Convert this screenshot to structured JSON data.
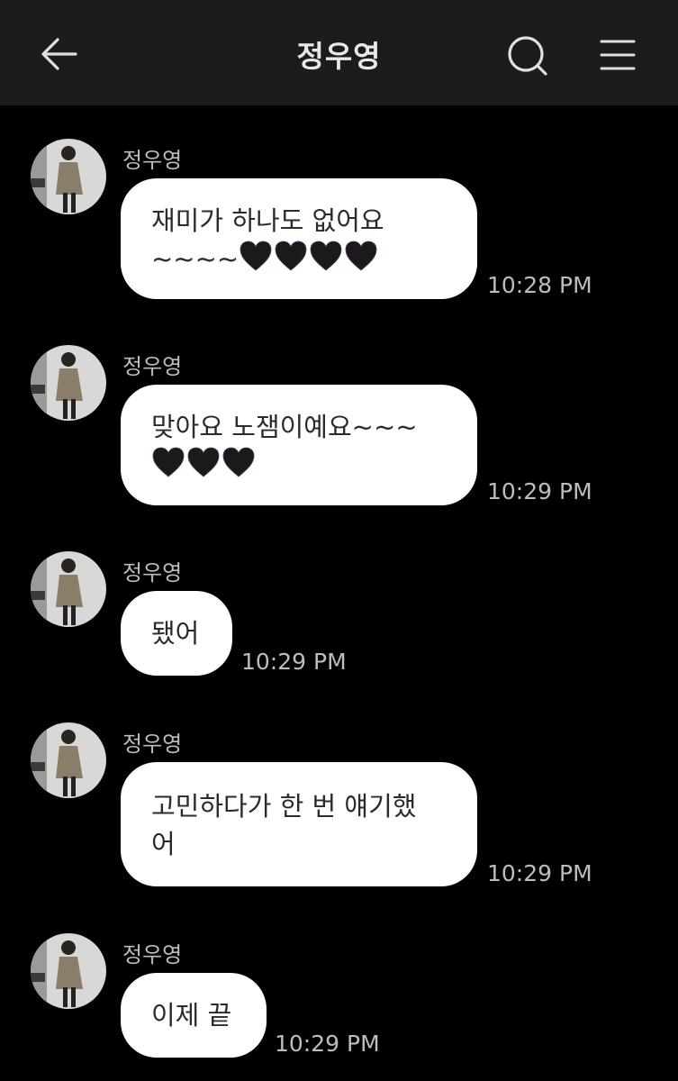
{
  "header": {
    "title": "정우영",
    "back_icon": "arrow-left-icon",
    "search_icon": "search-icon",
    "menu_icon": "hamburger-menu-icon"
  },
  "colors": {
    "background": "#000000",
    "header_bg": "#1c1c1e",
    "bubble": "#ffffff",
    "text_light": "#bdbdbd",
    "heart": "#1a1a1a"
  },
  "messages": [
    {
      "sender": "정우영",
      "lines": [
        "재미가 하나도 없어요",
        "~~~~"
      ],
      "hearts": 4,
      "time": "10:28 PM"
    },
    {
      "sender": "정우영",
      "lines": [
        "맞아요 노잼이예요~~~",
        ""
      ],
      "hearts": 3,
      "time": "10:29 PM"
    },
    {
      "sender": "정우영",
      "lines": [
        "됐어"
      ],
      "hearts": 0,
      "time": "10:29 PM"
    },
    {
      "sender": "정우영",
      "lines": [
        "고민하다가 한 번 얘기했",
        "어"
      ],
      "hearts": 0,
      "time": "10:29 PM"
    },
    {
      "sender": "정우영",
      "lines": [
        "이제 끝"
      ],
      "hearts": 0,
      "time": "10:29 PM"
    }
  ]
}
